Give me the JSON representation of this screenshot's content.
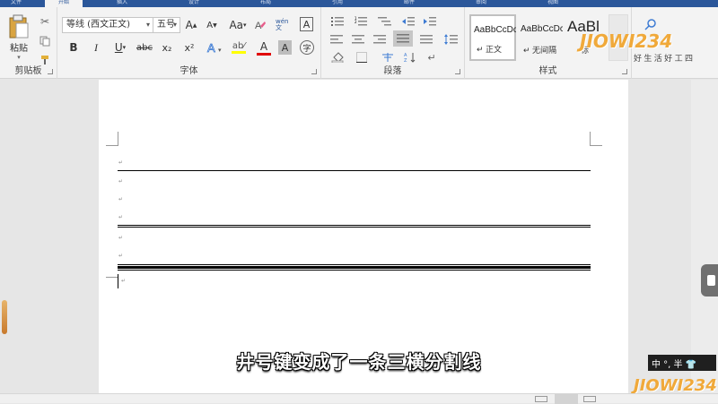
{
  "ribbon": {
    "tabs": [
      {
        "label": "文件",
        "active": false
      },
      {
        "label": "开始",
        "active": true
      },
      {
        "label": "插入",
        "active": false
      },
      {
        "label": "设计",
        "active": false
      },
      {
        "label": "布局",
        "active": false
      },
      {
        "label": "引用",
        "active": false
      },
      {
        "label": "邮件",
        "active": false
      },
      {
        "label": "审阅",
        "active": false
      },
      {
        "label": "视图",
        "active": false
      }
    ],
    "clipboard": {
      "group_label": "剪贴板",
      "paste_label": "粘贴"
    },
    "font": {
      "group_label": "字体",
      "font_name": "等线 (西文正文)",
      "font_size": "五号",
      "bold": "B",
      "italic": "I",
      "underline": "U",
      "strike": "abc",
      "subscript": "x₂",
      "superscript": "x²",
      "change_case": "Aa",
      "pinyin": "wén 文",
      "grow": "A",
      "shrink": "A",
      "char_shade": "A",
      "char_circle": "字"
    },
    "paragraph": {
      "group_label": "段落"
    },
    "styles": {
      "group_label": "样式",
      "items": [
        {
          "sample": "AaBbCcDc",
          "name": "正文"
        },
        {
          "sample": "AaBbCcDc",
          "name": "无间隔"
        },
        {
          "sample": "AaBl",
          "name": "标"
        }
      ]
    },
    "editing": {
      "chars": [
        "好",
        "生",
        "活",
        "好",
        "工",
        "四"
      ]
    }
  },
  "document": {
    "caption": "井号键变成了一条三横分割线",
    "para_mark": "↵"
  },
  "ime": {
    "label": "中 °, 半 👕"
  },
  "watermark": {
    "text": "JIOWI234"
  },
  "colors": {
    "ribbon_bg": "#f3f3f3",
    "title_blue": "#2b579a",
    "highlight_yellow": "#ffff00",
    "font_red": "#e00000"
  }
}
